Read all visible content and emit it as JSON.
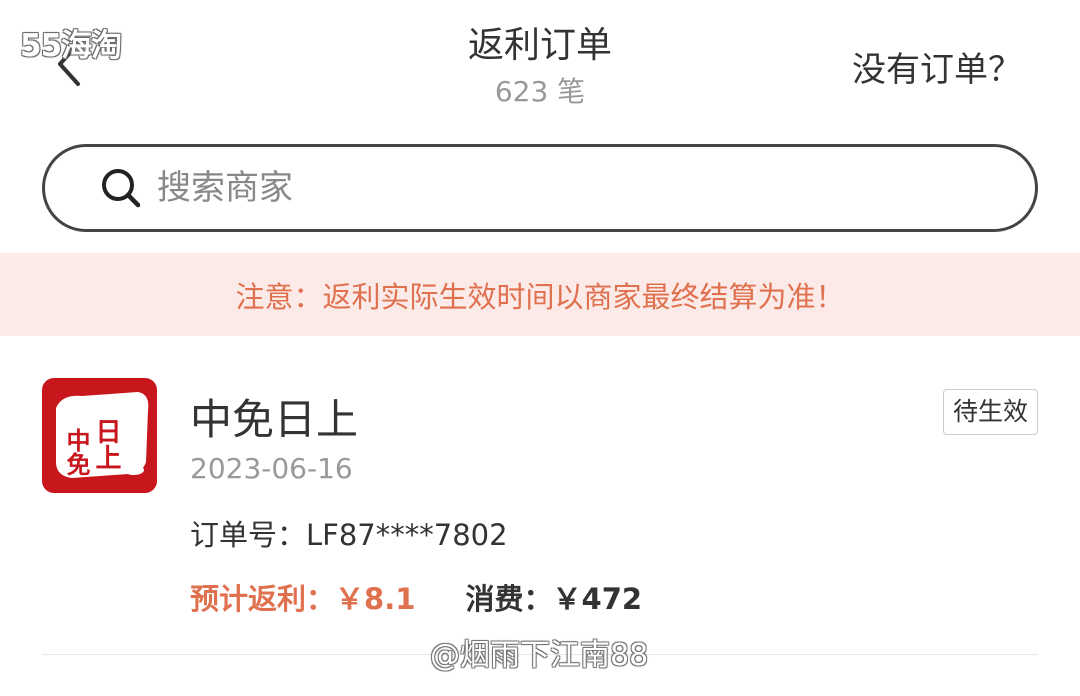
{
  "watermark_top": "55海淘",
  "header": {
    "title": "返利订单",
    "count": "623 笔",
    "no_order_link": "没有订单？"
  },
  "search": {
    "placeholder": "搜索商家"
  },
  "notice": "注意：返利实际生效时间以商家最终结算为准！",
  "orders": [
    {
      "merchant": "中免日上",
      "logo_text_left": "中免",
      "logo_text_right": "日上",
      "date": "2023-06-16",
      "status": "待生效",
      "order_no_label": "订单号：",
      "order_no": "LF87****7802",
      "rebate_label": "预计返利：",
      "rebate_value": "￥8.1",
      "spend_label": "消费：",
      "spend_value": "￥472"
    }
  ],
  "watermark_bottom": "@烟雨下江南88",
  "colors": {
    "accent": "#e0714f",
    "notice_bg": "#fbeae7",
    "logo_bg": "#c8161d"
  }
}
